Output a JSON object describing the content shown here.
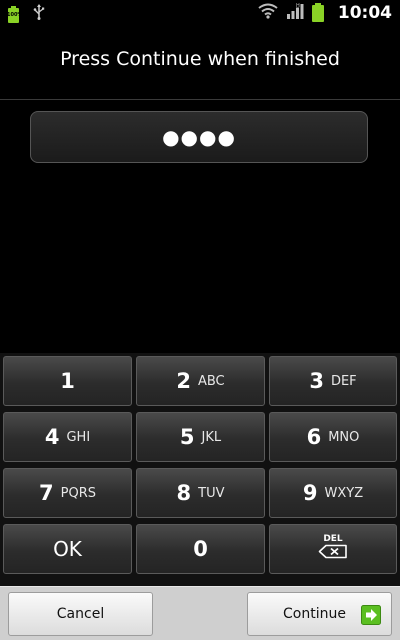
{
  "status_bar": {
    "battery_small_label": "100%",
    "time": "10:04",
    "icons": [
      "battery-icon",
      "usb-icon",
      "wifi-icon",
      "signal-icon",
      "battery-icon"
    ],
    "accent_color": "#8ad226"
  },
  "prompt": {
    "text": "Press Continue when finished"
  },
  "pin": {
    "masked_value": "●●●●"
  },
  "keypad": {
    "keys": [
      {
        "num": "1",
        "letters": ""
      },
      {
        "num": "2",
        "letters": "ABC"
      },
      {
        "num": "3",
        "letters": "DEF"
      },
      {
        "num": "4",
        "letters": "GHI"
      },
      {
        "num": "5",
        "letters": "JKL"
      },
      {
        "num": "6",
        "letters": "MNO"
      },
      {
        "num": "7",
        "letters": "PQRS"
      },
      {
        "num": "8",
        "letters": "TUV"
      },
      {
        "num": "9",
        "letters": "WXYZ"
      }
    ],
    "ok_label": "OK",
    "zero_label": "0",
    "del_label": "DEL"
  },
  "buttons": {
    "cancel_label": "Cancel",
    "continue_label": "Continue"
  }
}
